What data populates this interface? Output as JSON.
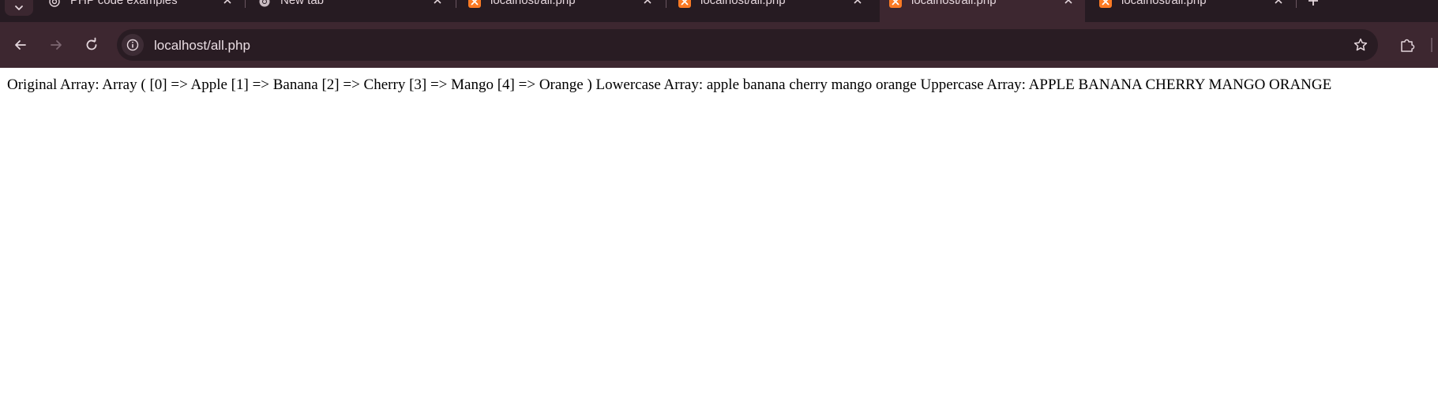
{
  "browser": {
    "tabs": [
      {
        "title": "PHP code examples",
        "icon": "chatgpt-icon",
        "active": false
      },
      {
        "title": "New tab",
        "icon": "chrome-icon",
        "active": false
      },
      {
        "title": "localhost/all.php",
        "icon": "xampp-icon",
        "active": false
      },
      {
        "title": "localhost/all.php",
        "icon": "xampp-icon",
        "active": false
      },
      {
        "title": "localhost/all.php",
        "icon": "xampp-icon",
        "active": true
      },
      {
        "title": "localhost/all.php",
        "icon": "xampp-icon",
        "active": false
      }
    ],
    "address_bar": {
      "url": "localhost/all.php"
    },
    "colors": {
      "tabstrip_bg": "#261b22",
      "toolbar_bg": "#3d2730",
      "omnibox_bg": "#291c23",
      "xampp_orange": "#fb7a24"
    }
  },
  "page": {
    "output_text": "Original Array: Array ( [0] => Apple [1] => Banana [2] => Cherry [3] => Mango [4] => Orange ) Lowercase Array: apple banana cherry mango orange Uppercase Array: APPLE BANANA CHERRY MANGO ORANGE"
  }
}
